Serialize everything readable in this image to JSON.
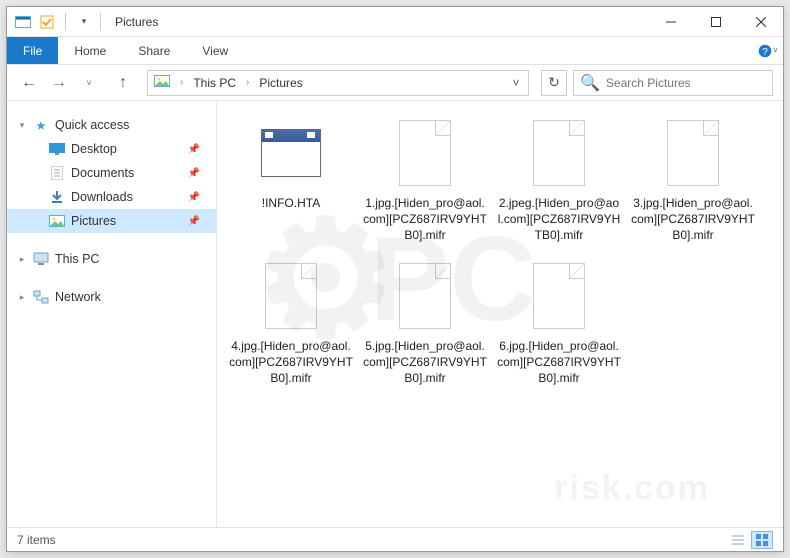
{
  "titlebar": {
    "title": "Pictures"
  },
  "ribbon": {
    "file": "File",
    "tabs": [
      "Home",
      "Share",
      "View"
    ]
  },
  "breadcrumb": {
    "segments": [
      "This PC",
      "Pictures"
    ]
  },
  "search": {
    "placeholder": "Search Pictures"
  },
  "sidebar": {
    "quick_access": {
      "label": "Quick access",
      "items": [
        {
          "label": "Desktop",
          "pinned": true,
          "icon": "desktop"
        },
        {
          "label": "Documents",
          "pinned": true,
          "icon": "documents"
        },
        {
          "label": "Downloads",
          "pinned": true,
          "icon": "downloads"
        },
        {
          "label": "Pictures",
          "pinned": true,
          "icon": "pictures",
          "selected": true
        }
      ]
    },
    "this_pc": {
      "label": "This PC"
    },
    "network": {
      "label": "Network"
    }
  },
  "files": [
    {
      "name": "!INFO.HTA",
      "kind": "hta"
    },
    {
      "name": "1.jpg.[Hiden_pro@aol.com][PCZ687IRV9YHTB0].mifr",
      "kind": "blank"
    },
    {
      "name": "2.jpeg.[Hiden_pro@aol.com][PCZ687IRV9YHTB0].mifr",
      "kind": "blank"
    },
    {
      "name": "3.jpg.[Hiden_pro@aol.com][PCZ687IRV9YHTB0].mifr",
      "kind": "blank"
    },
    {
      "name": "4.jpg.[Hiden_pro@aol.com][PCZ687IRV9YHTB0].mifr",
      "kind": "blank"
    },
    {
      "name": "5.jpg.[Hiden_pro@aol.com][PCZ687IRV9YHTB0].mifr",
      "kind": "blank"
    },
    {
      "name": "6.jpg.[Hiden_pro@aol.com][PCZ687IRV9YHTB0].mifr",
      "kind": "blank"
    }
  ],
  "status": {
    "count_label": "7 items"
  },
  "watermark": {
    "brand": "PC",
    "site": "risk.com"
  }
}
